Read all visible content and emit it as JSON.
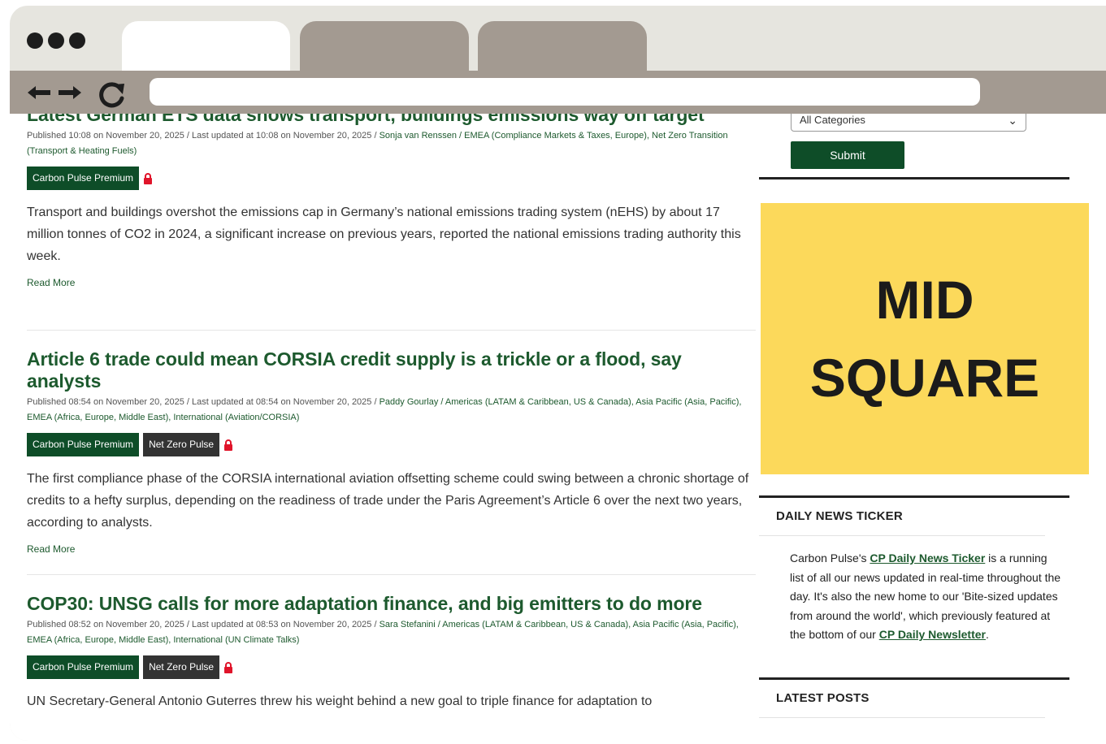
{
  "browser": {
    "tabs": [
      "",
      "",
      ""
    ],
    "url": ""
  },
  "articles": [
    {
      "title": "Latest German ETS data shows transport, buildings emissions way off target",
      "meta_prefix": "Published 10:08 on November 20, 2025 / Last updated at 10:08 on November 20, 2025 / ",
      "meta_links": "Sonja van Renssen / EMEA (Compliance Markets & Taxes, Europe), Net Zero Transition (Transport & Heating Fuels)",
      "badges": [
        "Carbon Pulse Premium"
      ],
      "excerpt": "Transport and buildings overshot the emissions cap in Germany’s national emissions trading system (nEHS) by about 17 million tonnes of CO2 in 2024, a significant increase on previous years, reported the national emissions trading authority this week.",
      "read_more": "Read More"
    },
    {
      "title": "Article 6 trade could mean CORSIA credit supply is a trickle or a flood, say analysts",
      "meta_prefix": "Published 08:54 on November 20, 2025 / Last updated at 08:54 on November 20, 2025 / ",
      "meta_links": "Paddy Gourlay / Americas (LATAM & Caribbean, US & Canada), Asia Pacific (Asia, Pacific), EMEA (Africa, Europe, Middle East), International (Aviation/CORSIA)",
      "badges": [
        "Carbon Pulse Premium",
        "Net Zero Pulse"
      ],
      "excerpt": "The first compliance phase of the CORSIA international aviation offsetting scheme could swing between a chronic shortage of credits to a hefty surplus, depending on the readiness of trade under the Paris Agreement’s Article 6 over the next two years, according to analysts.",
      "read_more": "Read More"
    },
    {
      "title": "COP30: UNSG calls for more adaptation finance, and big emitters to do more",
      "meta_prefix": "Published 08:52 on November 20, 2025 / Last updated at 08:53 on November 20, 2025 / ",
      "meta_links": "Sara Stefanini / Americas (LATAM & Caribbean, US & Canada), Asia Pacific (Asia, Pacific), EMEA (Africa, Europe, Middle East), International (UN Climate Talks)",
      "badges": [
        "Carbon Pulse Premium",
        "Net Zero Pulse"
      ],
      "excerpt": "UN Secretary-General Antonio Guterres threw his weight behind a new goal to triple finance for adaptation to",
      "read_more": "Read More"
    }
  ],
  "sidebar": {
    "category_select": "All Categories",
    "submit_label": "Submit",
    "ad_line1": "MID",
    "ad_line2": "SQUARE",
    "ticker_heading": "DAILY NEWS TICKER",
    "ticker_text_1": "Carbon Pulse's ",
    "ticker_link_1": "CP Daily News Ticker",
    "ticker_text_2": " is a running list of all our news updated in real-time throughout the day. It's also the new home to our 'Bite-sized updates from around the world', which previously featured at the bottom of our ",
    "ticker_link_2": "CP Daily Newsletter",
    "ticker_text_3": ".",
    "latest_heading": "LATEST POSTS"
  },
  "colors": {
    "brand_green": "#1d5a2e",
    "premium_badge": "#0e4d28",
    "netzero_badge": "#333333",
    "lock": "#e0142a",
    "ad_bg": "#fcd95b",
    "browser_chrome": "#a39a91"
  },
  "icons": {
    "back": "arrow-left-icon",
    "forward": "arrow-right-icon",
    "reload": "reload-icon",
    "lock": "lock-icon",
    "dropdown": "chevron-down-icon"
  }
}
